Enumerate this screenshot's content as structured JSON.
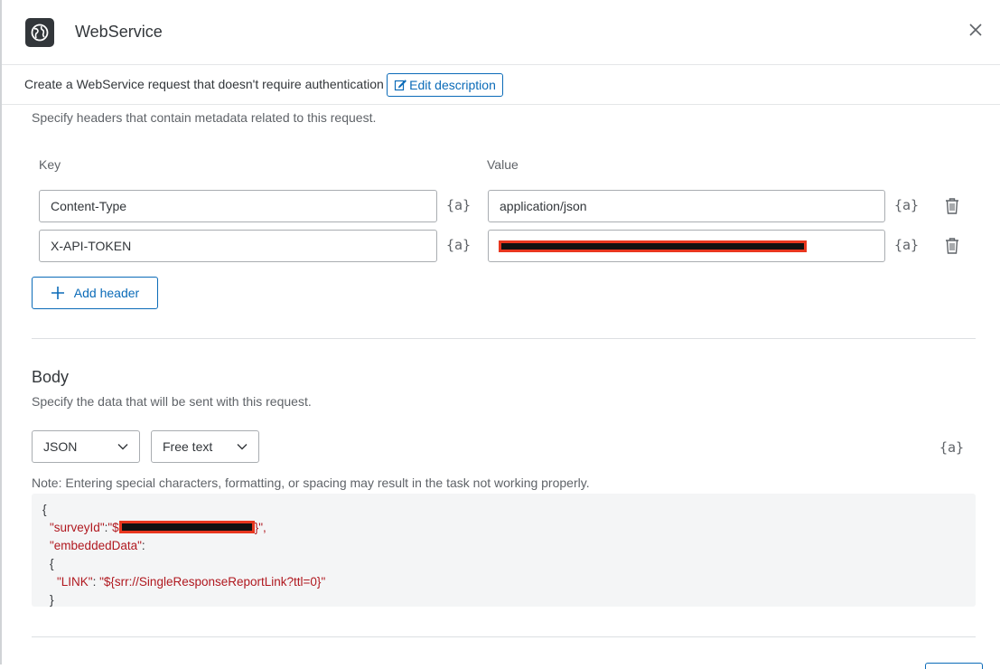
{
  "header": {
    "title": "WebService",
    "app_icon": "globe-icon",
    "close_icon": "close-icon"
  },
  "description": {
    "text": "Create a WebService request that doesn't require authentication",
    "edit_label": "Edit description"
  },
  "headers_section": {
    "helper": "Specify headers that contain metadata related to this request.",
    "key_label": "Key",
    "value_label": "Value",
    "pipe_label": "{a}",
    "rows": [
      {
        "key": "Content-Type",
        "value": "application/json",
        "redacted": false
      },
      {
        "key": "X-API-TOKEN",
        "value": "",
        "redacted": true
      }
    ],
    "add_label": "Add header"
  },
  "body_section": {
    "title": "Body",
    "helper": "Specify the data that will be sent with this request.",
    "format_value": "JSON",
    "mode_value": "Free text",
    "pipe_label": "{a}",
    "note": "Note: Entering special characters, formatting, or spacing may result in the task not working properly.",
    "code": {
      "line1": "{",
      "survey_key": "\"surveyId\"",
      "colon": ":",
      "survey_open": "\"$",
      "survey_close": "}\",",
      "embedded_key": "\"embeddedData\"",
      "embedded_colon": ":",
      "brace_open": "{",
      "link_key": "\"LINK\"",
      "link_colon": ": ",
      "link_value": "\"${srr://SingleResponseReportLink?ttl=0}\"",
      "brace_close": "}"
    }
  },
  "colors": {
    "accent": "#0b6bb8",
    "redaction_border": "#e8371f",
    "code_string": "#b0181f"
  }
}
